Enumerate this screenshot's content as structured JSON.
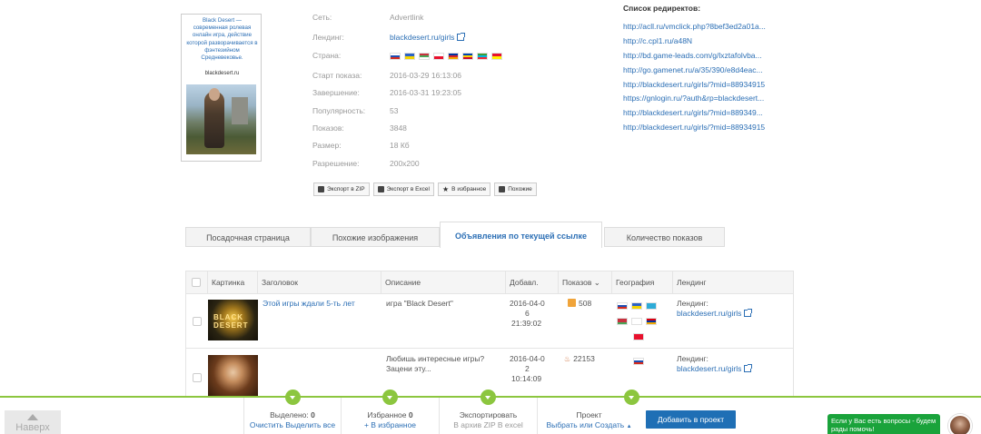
{
  "ad": {
    "title": "Black Desert — современная ролевая онлайн игра, действие которой разворачивается в фэнтезийном Средневековье.",
    "domain": "blackdesert.ru"
  },
  "info": {
    "network_label": "Сеть:",
    "network_value": "Advertlink",
    "landing_label": "Лендинг:",
    "landing_value": "blackdesert.ru/girls",
    "country_label": "Страна:",
    "start_label": "Старт показа:",
    "start_value": "2016-03-29 16:13:06",
    "end_label": "Завершение:",
    "end_value": "2016-03-31 19:23:05",
    "popularity_label": "Популярность:",
    "popularity_value": "53",
    "shows_label": "Показов:",
    "shows_value": "3848",
    "size_label": "Размер:",
    "size_value": "18 Кб",
    "resolution_label": "Разрешение:",
    "resolution_value": "200x200",
    "flags": [
      "#ffffff,#1e4fb3,#d52b1e",
      "#2b63c6,#f4d400",
      "#c8313e,#4aa657,#ffffff",
      "#ffffff,#e8112d",
      "#0033a0,#d8212b,#f2a800",
      "#0046ae,#ffd200,#cc092f",
      "#3f9c35,#00b5e2,#ed2939",
      "#e8112d,#ffef00"
    ]
  },
  "buttons": {
    "zip": "Экспорт в ZIP",
    "excel": "Экспорт в Excel",
    "favorites": "В избранное",
    "similar": "Похожие"
  },
  "redirects": {
    "title": "Список редиректов:",
    "items": [
      "http://acll.ru/vmclick.php?8bef3ed2a01a...",
      "http://c.cpl1.ru/a48N",
      "http://bd.game-leads.com/g/lxztafolvba...",
      "http://go.gamenet.ru/a/35/390/e8d4eac...",
      "http://blackdesert.ru/girls/?mid=88934915",
      "https://gnlogin.ru/?auth&rp=blackdesert...",
      "http://blackdesert.ru/girls/?mid=889349...",
      "http://blackdesert.ru/girls/?mid=88934915"
    ]
  },
  "tabs": [
    "Посадочная страница",
    "Похожие изображения",
    "Объявления по текущей ссылке",
    "Количество показов"
  ],
  "table": {
    "headers": {
      "picture": "Картинка",
      "title": "Заголовок",
      "description": "Описание",
      "added": "Добавл.",
      "shows": "Показов",
      "geo": "География",
      "landing": "Лендинг"
    },
    "rows": [
      {
        "title": "Этой игры ждали 5-ть лет",
        "description": "игра \"Black Desert\"",
        "added_1": "2016-04-0",
        "added_2": "6",
        "added_3": "21:39:02",
        "shows": "508",
        "landing_label": "Лендинг:",
        "landing_link": "blackdesert.ru/girls",
        "thumb_text": "BLACK DESERT"
      },
      {
        "title": "",
        "description_1": "Любишь интересные игры?",
        "description_2": "Зацени эту...",
        "added_1": "2016-04-0",
        "added_2": "2",
        "added_3": "10:14:09",
        "shows": "22153",
        "landing_label": "Лендинг:",
        "landing_link": "blackdesert.ru/girls"
      }
    ]
  },
  "bottom": {
    "scroll_up": "Наверх",
    "selected_label": "Выделено:",
    "selected_count": "0",
    "selected_action": "Очистить Выделить все",
    "fav_label": "Избранное",
    "fav_count": "0",
    "fav_action": "+ В избранное",
    "export_label": "Экспортировать",
    "export_action": "В архив ZIP В excel",
    "project_label": "Проект",
    "project_action": "Выбрать или Создать",
    "add_project": "Добавить в проект",
    "help_text": "Если у Вас есть вопросы - будем рады помочь!"
  },
  "colors": {
    "accent": "#2c6fb5",
    "green": "#8cc63f",
    "help_green": "#1aa33b",
    "primary_button": "#1f6fb5"
  }
}
